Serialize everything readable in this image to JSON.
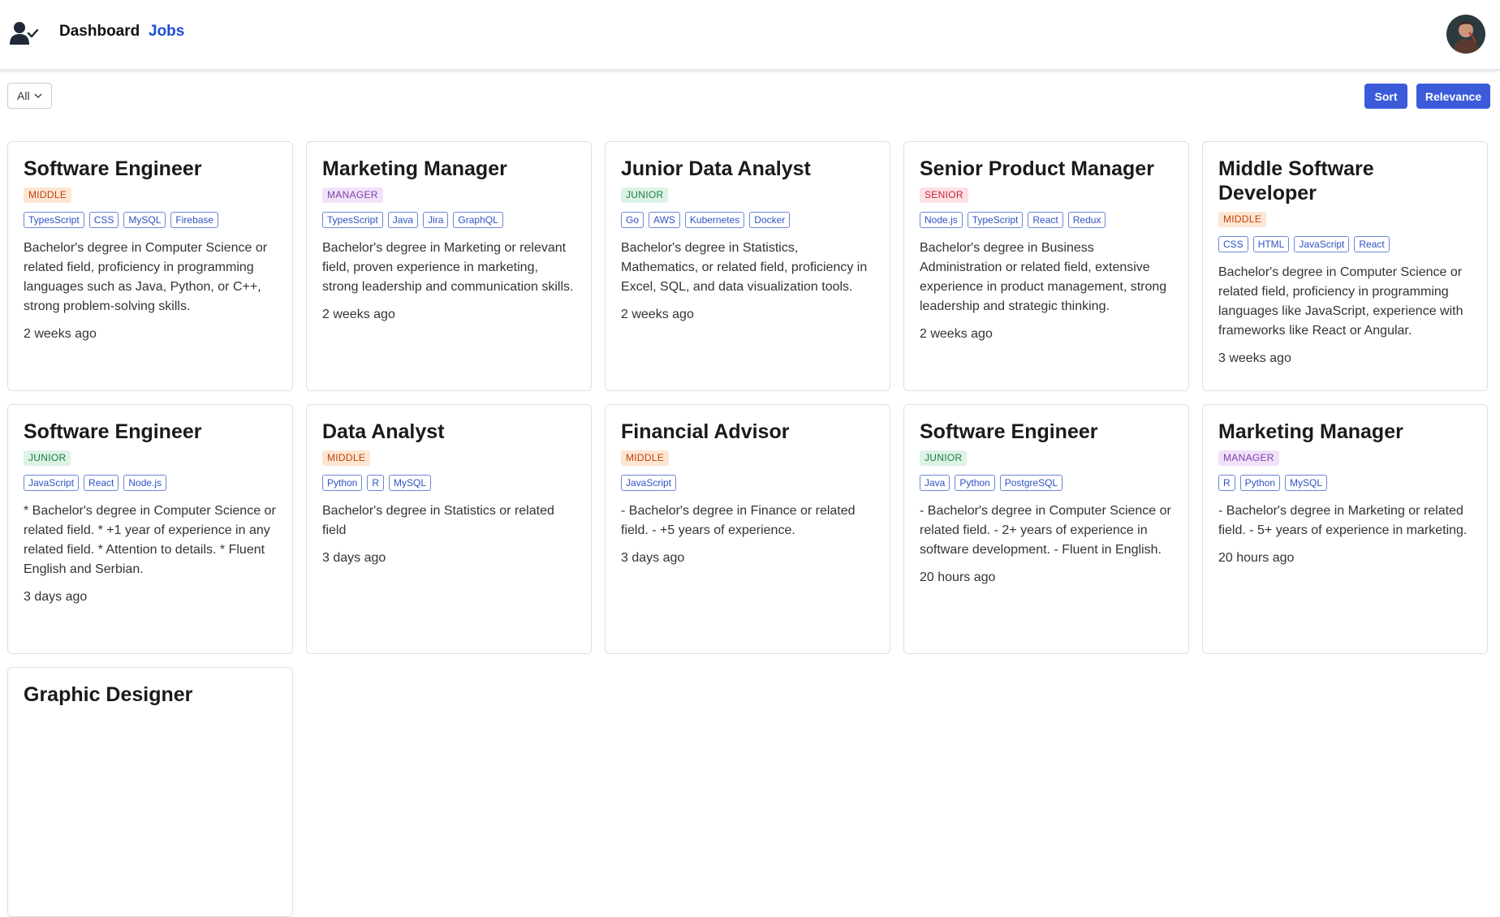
{
  "nav": {
    "dashboard": "Dashboard",
    "jobs": "Jobs",
    "icons": {
      "logo": "user-check-icon",
      "avatar": "user-avatar"
    }
  },
  "toolbar": {
    "filter_value": "All",
    "sort_label": "Sort",
    "relevance_label": "Relevance"
  },
  "colors": {
    "accent": "#3b5bdb",
    "active_link": "#1d4ed8",
    "level_middle": "#c2410c",
    "level_manager": "#7e3fa8",
    "level_junior": "#1f7a44",
    "level_senior": "#c8233b"
  },
  "jobs": [
    {
      "title": "Software Engineer",
      "level": "MIDDLE",
      "level_kind": "middle",
      "tags": [
        "TypesScript",
        "CSS",
        "MySQL",
        "Firebase"
      ],
      "description": "Bachelor's degree in Computer Science or related field, proficiency in programming languages such as Java, Python, or C++, strong problem-solving skills.",
      "posted": "2 weeks ago"
    },
    {
      "title": "Marketing Manager",
      "level": "MANAGER",
      "level_kind": "manager",
      "tags": [
        "TypesScript",
        "Java",
        "Jira",
        "GraphQL"
      ],
      "description": "Bachelor's degree in Marketing or relevant field, proven experience in marketing, strong leadership and communication skills.",
      "posted": "2 weeks ago"
    },
    {
      "title": "Junior Data Analyst",
      "level": "JUNIOR",
      "level_kind": "junior",
      "tags": [
        "Go",
        "AWS",
        "Kubernetes",
        "Docker"
      ],
      "description": "Bachelor's degree in Statistics, Mathematics, or related field, proficiency in Excel, SQL, and data visualization tools.",
      "posted": "2 weeks ago"
    },
    {
      "title": "Senior Product Manager",
      "level": "SENIOR",
      "level_kind": "senior",
      "tags": [
        "Node.js",
        "TypeScript",
        "React",
        "Redux"
      ],
      "description": "Bachelor's degree in Business Administration or related field, extensive experience in product management, strong leadership and strategic thinking.",
      "posted": "2 weeks ago"
    },
    {
      "title": "Middle Software Developer",
      "level": "MIDDLE",
      "level_kind": "middle",
      "tags": [
        "CSS",
        "HTML",
        "JavaScript",
        "React"
      ],
      "description": "Bachelor's degree in Computer Science or related field, proficiency in programming languages like JavaScript, experience with frameworks like React or Angular.",
      "posted": "3 weeks ago"
    },
    {
      "title": "Software Engineer",
      "level": "JUNIOR",
      "level_kind": "junior",
      "tags": [
        "JavaScript",
        "React",
        "Node.js"
      ],
      "description": "* Bachelor's degree in Computer Science or related field. * +1 year of experience in any related field. * Attention to details. * Fluent English and Serbian.",
      "posted": "3 days ago"
    },
    {
      "title": "Data Analyst",
      "level": "MIDDLE",
      "level_kind": "middle",
      "tags": [
        "Python",
        "R",
        "MySQL"
      ],
      "description": "Bachelor's degree in Statistics or related field",
      "posted": "3 days ago"
    },
    {
      "title": "Financial Advisor",
      "level": "MIDDLE",
      "level_kind": "middle",
      "tags": [
        "JavaScript"
      ],
      "description": "- Bachelor's degree in Finance or related field. - +5 years of experience.",
      "posted": "3 days ago"
    },
    {
      "title": "Software Engineer",
      "level": "JUNIOR",
      "level_kind": "junior",
      "tags": [
        "Java",
        "Python",
        "PostgreSQL"
      ],
      "description": "- Bachelor's degree in Computer Science or related field. - 2+ years of experience in software development. - Fluent in English.",
      "posted": "20 hours ago"
    },
    {
      "title": "Marketing Manager",
      "level": "MANAGER",
      "level_kind": "manager",
      "tags": [
        "R",
        "Python",
        "MySQL"
      ],
      "description": "- Bachelor's degree in Marketing or related field. - 5+ years of experience in marketing.",
      "posted": "20 hours ago"
    },
    {
      "title": "Graphic Designer",
      "level": "",
      "level_kind": "",
      "tags": [],
      "description": "",
      "posted": ""
    }
  ]
}
